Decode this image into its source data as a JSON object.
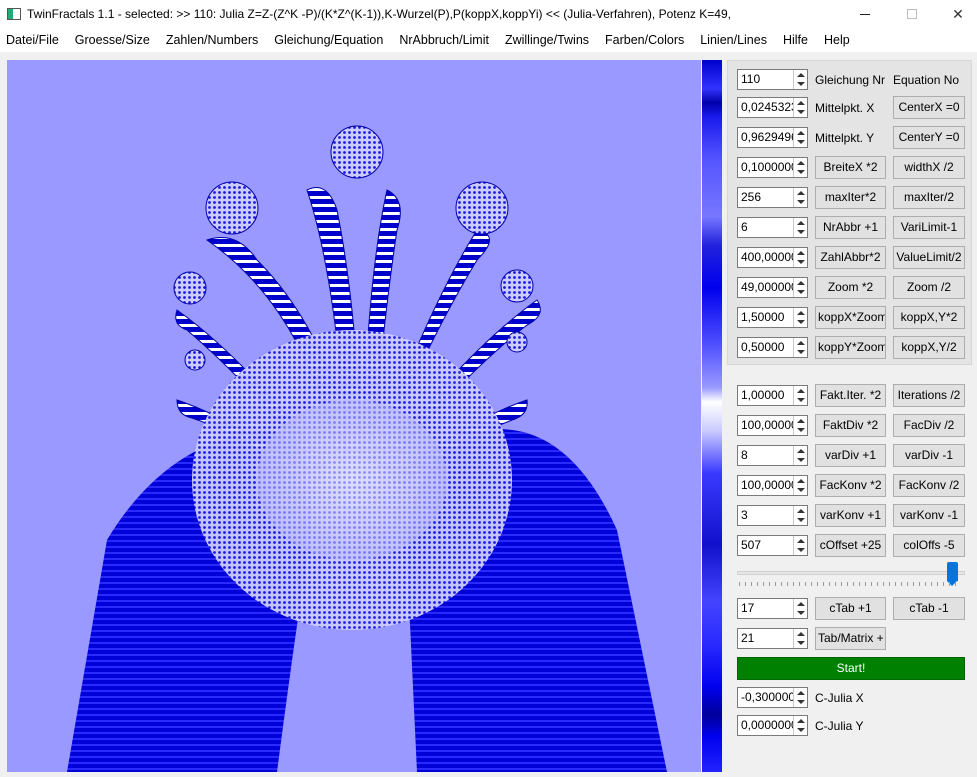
{
  "window": {
    "title": "TwinFractals 1.1 - selected: >> 110: Julia Z=Z-(Z^K -P)/(K*Z^(K-1)),K-Wurzel(P),P(koppX,koppYi)  << (Julia-Verfahren), Potenz K=49,"
  },
  "menu": [
    "Datei/File",
    "Groesse/Size",
    "Zahlen/Numbers",
    "Gleichung/Equation",
    "NrAbbruch/Limit",
    "Zwillinge/Twins",
    "Farben/Colors",
    "Linien/Lines",
    "Hilfe",
    "Help"
  ],
  "colors": {
    "fractal_background": "#9999ff",
    "fractal_dark": "#0000cc",
    "start_button": "#008000"
  },
  "controls_top": [
    {
      "value": "110",
      "button1": "Gleichung Nr",
      "button2": "Equation No",
      "b1_is_label": true,
      "b2_is_label": true
    },
    {
      "value": "0,0245323(",
      "button1": "Mittelpkt. X",
      "button2": "CenterX =0",
      "b1_is_label": true
    },
    {
      "value": "0,9629496(",
      "button1": "Mittelpkt. Y",
      "button2": "CenterY =0",
      "b1_is_label": true
    },
    {
      "value": "0,1000000",
      "button1": "BreiteX *2",
      "button2": "widthX /2"
    },
    {
      "value": "256",
      "button1": "maxIter*2",
      "button2": "maxIter/2"
    },
    {
      "value": "6",
      "button1": "NrAbbr +1",
      "button2": "VariLimit-1"
    },
    {
      "value": "400,000000",
      "button1": "ZahlAbbr*2",
      "button2": "ValueLimit/2"
    },
    {
      "value": "49,000000",
      "button1": "Zoom *2",
      "button2": "Zoom /2"
    },
    {
      "value": "1,50000",
      "button1": "koppX*Zoom",
      "button2": "koppX,Y*2"
    },
    {
      "value": "0,50000",
      "button1": "koppY*Zoom",
      "button2": "koppX,Y/2"
    }
  ],
  "controls_bottom": [
    {
      "value": "1,00000",
      "button1": "Fakt.Iter. *2",
      "button2": "Iterations /2"
    },
    {
      "value": "100,000000",
      "button1": "FaktDiv *2",
      "button2": "FacDiv /2"
    },
    {
      "value": "8",
      "button1": "varDiv +1",
      "button2": "varDiv -1"
    },
    {
      "value": "100,000000",
      "button1": "FacKonv *2",
      "button2": "FacKonv /2"
    },
    {
      "value": "3",
      "button1": "varKonv +1",
      "button2": "varKonv -1"
    },
    {
      "value": "507",
      "button1": "cOffset +25",
      "button2": "colOffs -5"
    }
  ],
  "color_slider": {
    "level_fraction": 0.97
  },
  "ctab": {
    "value": "17",
    "button1": "cTab +1",
    "button2": "cTab -1"
  },
  "tab_matrix": {
    "value": "21",
    "button1": "Tab/Matrix +"
  },
  "start_label": "Start!",
  "julia": [
    {
      "value": "-0,300000(",
      "label": "C-Julia X"
    },
    {
      "value": "0,0000000(",
      "label": "C-Julia Y"
    }
  ]
}
